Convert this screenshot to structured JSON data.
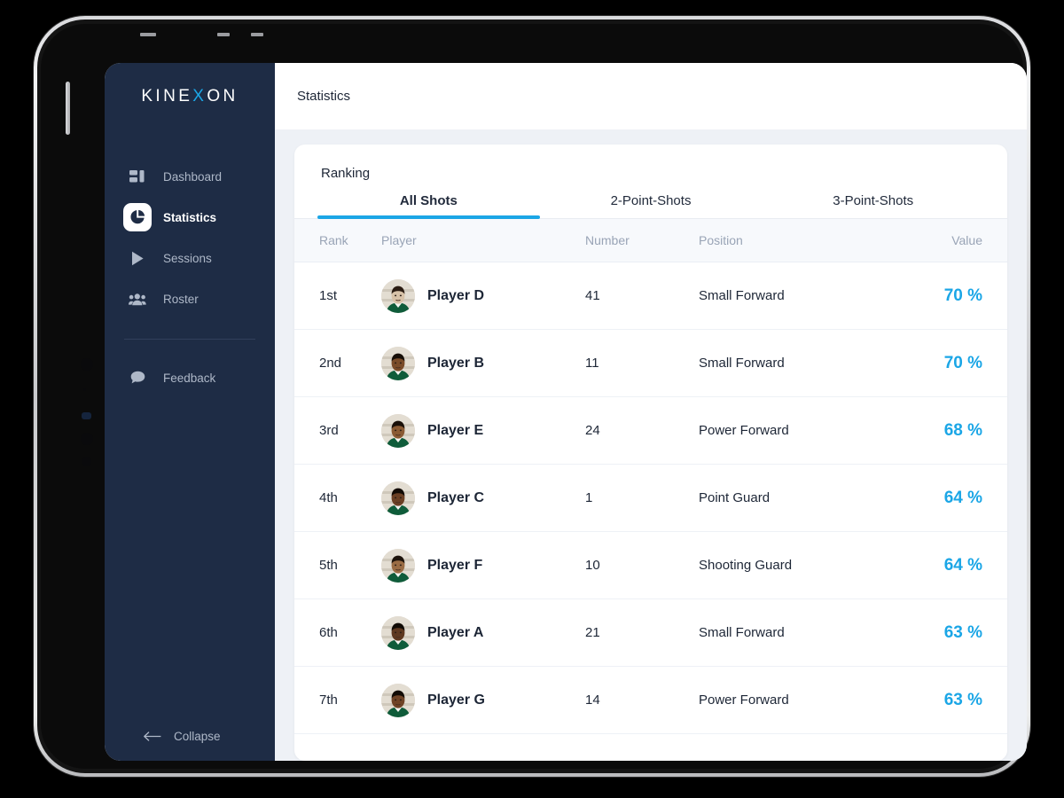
{
  "brand": {
    "name_before": "KINE",
    "accent_letter": "X",
    "name_after": "ON"
  },
  "sidebar": {
    "primary_items": [
      {
        "label": "Dashboard",
        "icon": "dashboard-icon",
        "active": false
      },
      {
        "label": "Statistics",
        "icon": "pie-chart-icon",
        "active": true
      },
      {
        "label": "Sessions",
        "icon": "play-icon",
        "active": false
      },
      {
        "label": "Roster",
        "icon": "people-icon",
        "active": false
      }
    ],
    "secondary_items": [
      {
        "label": "Feedback",
        "icon": "chat-bubble-icon",
        "active": false
      }
    ],
    "collapse_label": "Collapse",
    "collapse_icon": "arrow-left-icon"
  },
  "topbar": {
    "title": "Statistics"
  },
  "card": {
    "title": "Ranking",
    "tabs": [
      {
        "label": "All Shots",
        "active": true
      },
      {
        "label": "2-Point-Shots",
        "active": false
      },
      {
        "label": "3-Point-Shots",
        "active": false
      }
    ],
    "columns": {
      "rank": "Rank",
      "player": "Player",
      "number": "Number",
      "position": "Position",
      "value": "Value"
    },
    "rows": [
      {
        "rank": "1st",
        "player": "Player D",
        "number": "41",
        "position": "Small Forward",
        "value": "70 %"
      },
      {
        "rank": "2nd",
        "player": "Player B",
        "number": "11",
        "position": "Small Forward",
        "value": "70 %"
      },
      {
        "rank": "3rd",
        "player": "Player E",
        "number": "24",
        "position": "Power Forward",
        "value": "68 %"
      },
      {
        "rank": "4th",
        "player": "Player C",
        "number": "1",
        "position": "Point Guard",
        "value": "64 %"
      },
      {
        "rank": "5th",
        "player": "Player F",
        "number": "10",
        "position": "Shooting Guard",
        "value": "64 %"
      },
      {
        "rank": "6th",
        "player": "Player A",
        "number": "21",
        "position": "Small Forward",
        "value": "63 %"
      },
      {
        "rank": "7th",
        "player": "Player G",
        "number": "14",
        "position": "Power Forward",
        "value": "63 %"
      }
    ]
  },
  "colors": {
    "accent": "#1ba6e6",
    "sidebar_bg": "#1e2c45",
    "page_bg": "#eef1f6",
    "text_dark": "#1d2636",
    "header_text": "#99a4b6"
  }
}
